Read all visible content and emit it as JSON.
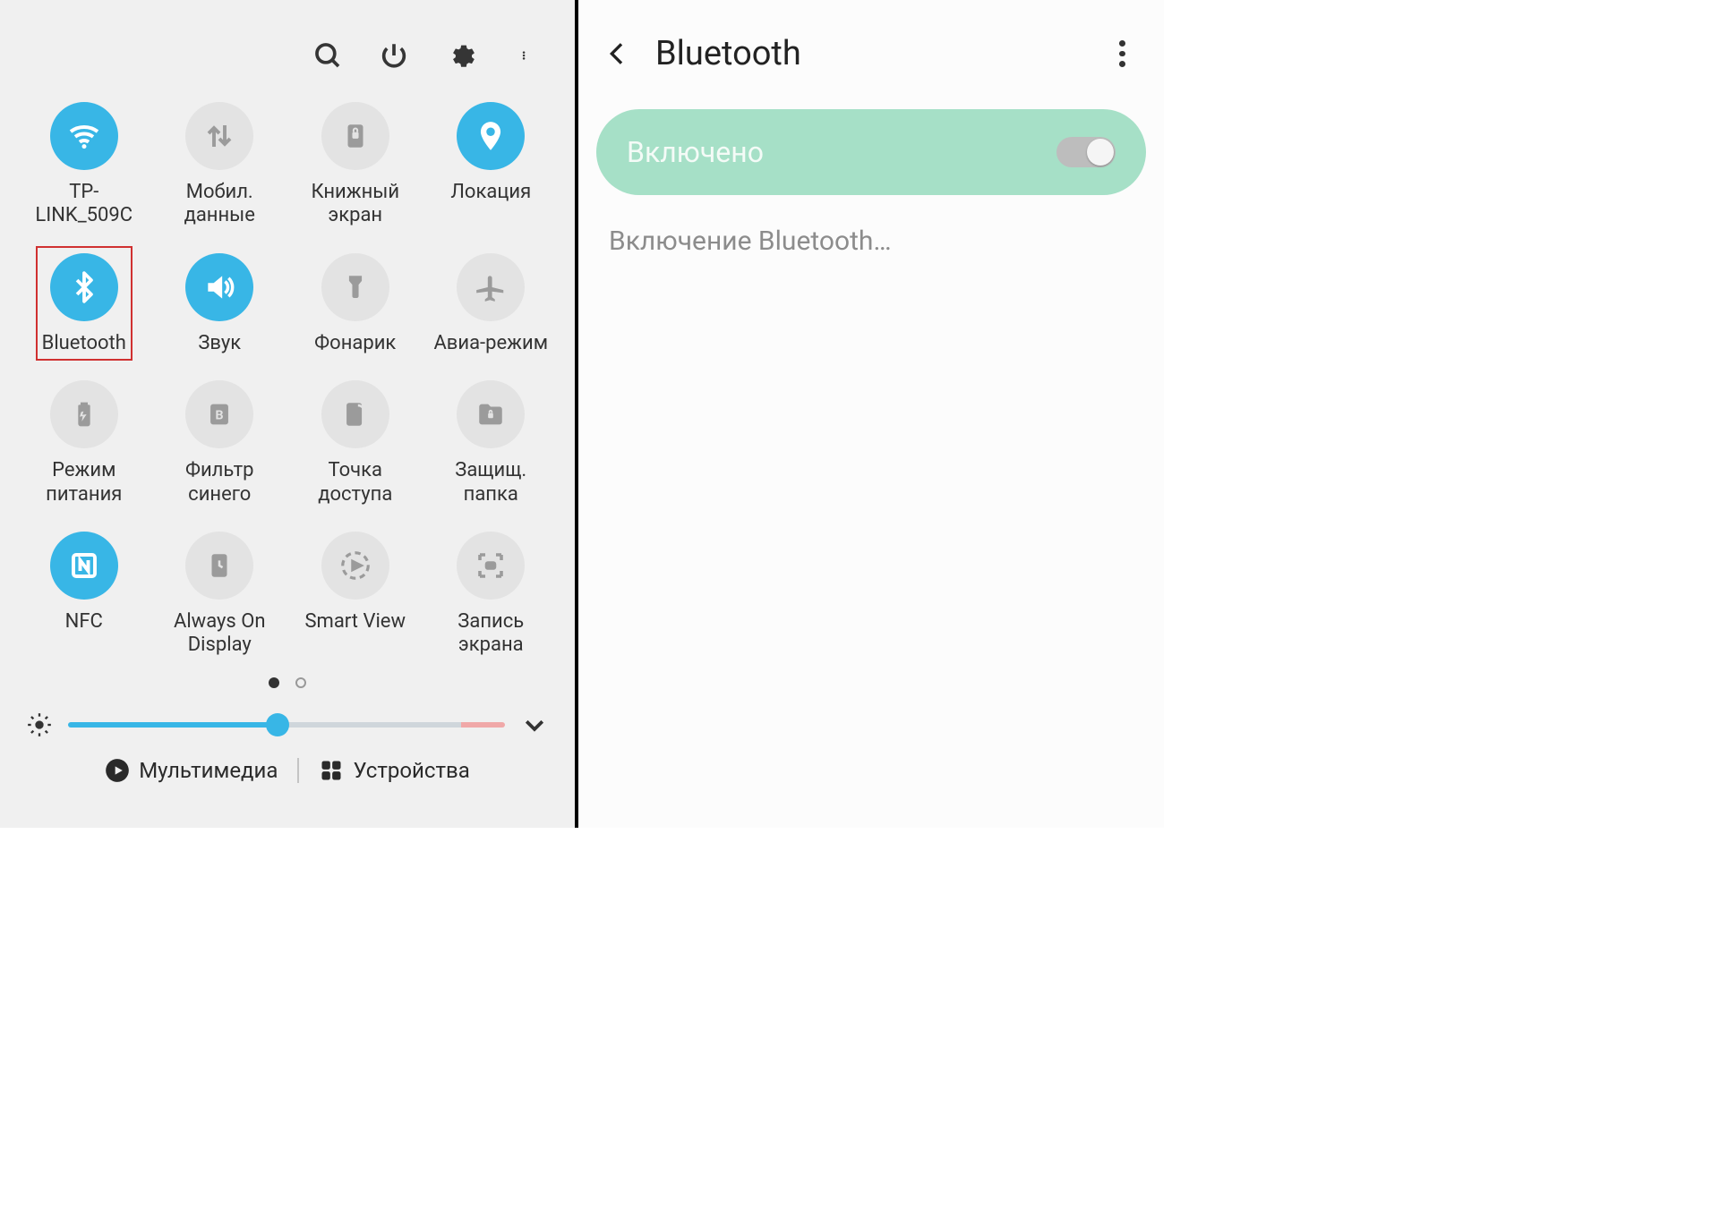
{
  "colors": {
    "accent": "#38b6e6",
    "tile_off_bg": "#e3e3e3",
    "toggle_bg": "#a6e0c7",
    "highlight": "#d03030"
  },
  "quick_settings": {
    "top_icons": [
      "search",
      "power",
      "settings",
      "more"
    ],
    "tiles": [
      {
        "id": "wifi",
        "label": "TP-LINK_509C",
        "active": true,
        "icon": "wifi"
      },
      {
        "id": "mobiledata",
        "label": "Мобил. данные",
        "active": false,
        "icon": "data"
      },
      {
        "id": "booklock",
        "label": "Книжный экран",
        "active": false,
        "icon": "booklock"
      },
      {
        "id": "location",
        "label": "Локация",
        "active": true,
        "icon": "location"
      },
      {
        "id": "bluetooth",
        "label": "Bluetooth",
        "active": true,
        "icon": "bluetooth",
        "highlight": true
      },
      {
        "id": "sound",
        "label": "Звук",
        "active": true,
        "icon": "sound"
      },
      {
        "id": "flashlight",
        "label": "Фонарик",
        "active": false,
        "icon": "flashlight"
      },
      {
        "id": "airplane",
        "label": "Авиа-режим",
        "active": false,
        "icon": "airplane"
      },
      {
        "id": "powermode",
        "label": "Режим питания",
        "active": false,
        "icon": "powermode"
      },
      {
        "id": "bluefilter",
        "label": "Фильтр синего",
        "active": false,
        "icon": "bluefilter"
      },
      {
        "id": "hotspot",
        "label": "Точка доступа",
        "active": false,
        "icon": "hotspot"
      },
      {
        "id": "securefolder",
        "label": "Защищ. папка",
        "active": false,
        "icon": "securefolder"
      },
      {
        "id": "nfc",
        "label": "NFC",
        "active": true,
        "icon": "nfc"
      },
      {
        "id": "aod",
        "label": "Always On Display",
        "active": false,
        "icon": "aod"
      },
      {
        "id": "smartview",
        "label": "Smart View",
        "active": false,
        "icon": "smartview"
      },
      {
        "id": "screenrec",
        "label": "Запись экрана",
        "active": false,
        "icon": "screenrec"
      }
    ],
    "page_indicator": {
      "count": 2,
      "active": 0
    },
    "brightness_percent": 48,
    "bottom": {
      "media_label": "Мультимедиа",
      "devices_label": "Устройства"
    }
  },
  "bluetooth_page": {
    "title": "Bluetooth",
    "toggle_label": "Включено",
    "toggle_on": true,
    "status_text": "Включение Bluetooth…"
  }
}
